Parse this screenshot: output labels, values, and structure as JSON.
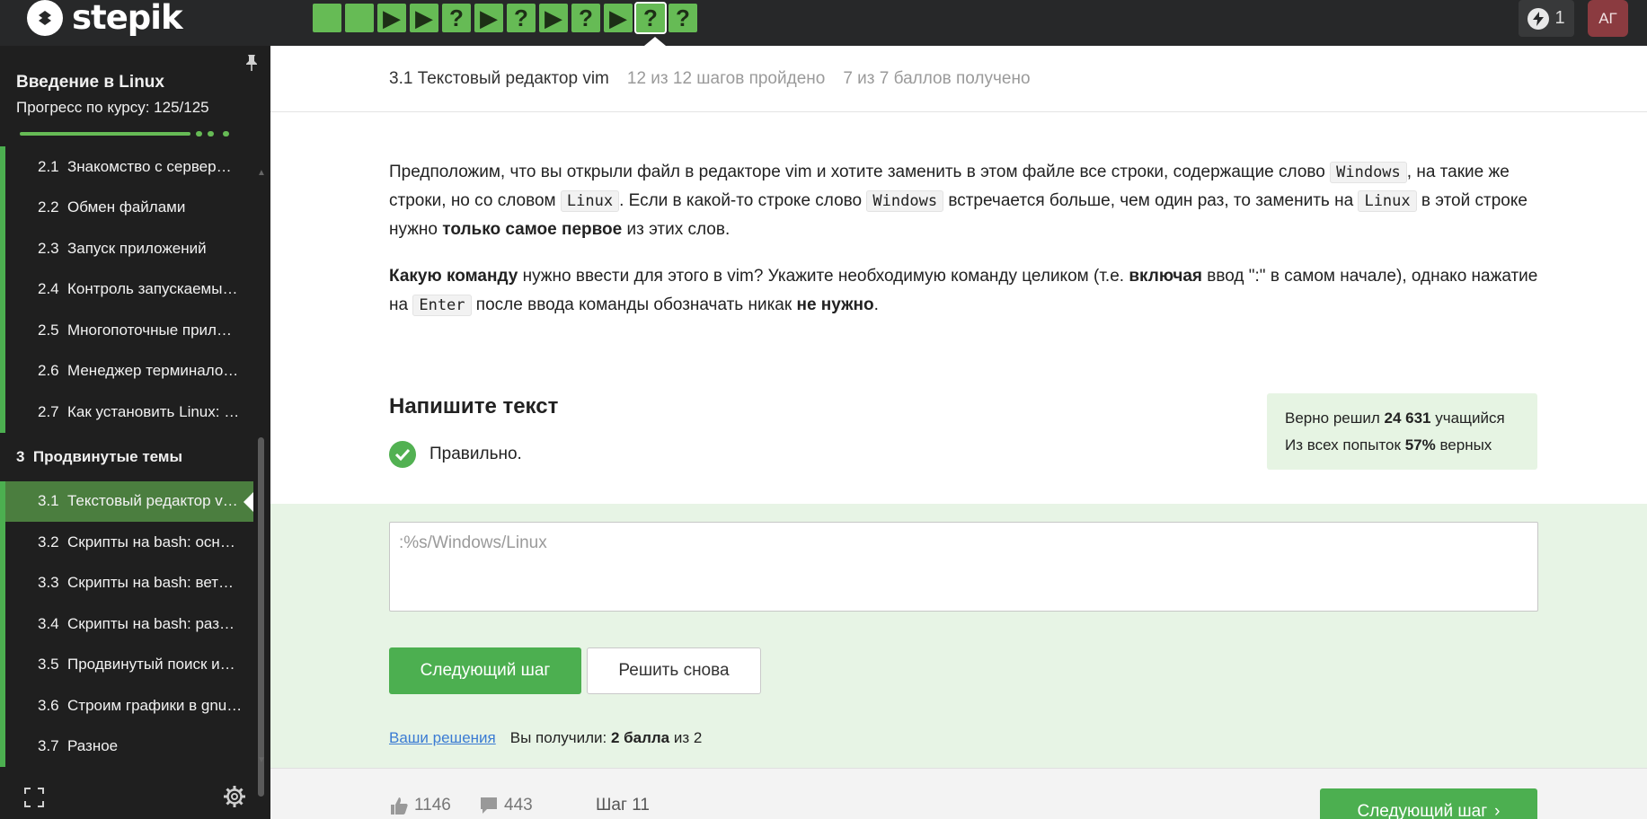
{
  "brand": {
    "name": "stepik"
  },
  "steps": [
    {
      "kind": "text",
      "icon": "",
      "state": "done"
    },
    {
      "kind": "text",
      "icon": "",
      "state": "done"
    },
    {
      "kind": "video",
      "icon": "▶",
      "state": "done"
    },
    {
      "kind": "video",
      "icon": "▶",
      "state": "done"
    },
    {
      "kind": "quiz",
      "icon": "?",
      "state": "done"
    },
    {
      "kind": "video",
      "icon": "▶",
      "state": "done"
    },
    {
      "kind": "quiz",
      "icon": "?",
      "state": "done"
    },
    {
      "kind": "video",
      "icon": "▶",
      "state": "done"
    },
    {
      "kind": "quiz",
      "icon": "?",
      "state": "done"
    },
    {
      "kind": "video",
      "icon": "▶",
      "state": "done"
    },
    {
      "kind": "quiz",
      "icon": "?",
      "state": "current"
    },
    {
      "kind": "quiz",
      "icon": "?",
      "state": "done"
    }
  ],
  "header": {
    "energy_count": "1",
    "avatar_initials": "АГ"
  },
  "sidebar": {
    "course_title": "Введение в Linux",
    "progress_label": "Прогресс по курсу:  125/125",
    "progress_fraction": 1.0,
    "lessons_before": [
      {
        "num": "2.1",
        "title": "Знакомство с сервер…"
      },
      {
        "num": "2.2",
        "title": "Обмен файлами"
      },
      {
        "num": "2.3",
        "title": "Запуск приложений"
      },
      {
        "num": "2.4",
        "title": "Контроль запускаемы…"
      },
      {
        "num": "2.5",
        "title": "Многопоточные прил…"
      },
      {
        "num": "2.6",
        "title": "Менеджер терминало…"
      },
      {
        "num": "2.7",
        "title": "Как установить Linux: …"
      }
    ],
    "section": {
      "num": "3",
      "title": "Продвинутые темы"
    },
    "lessons_after": [
      {
        "num": "3.1",
        "title": "Текстовый редактор v…",
        "active": true
      },
      {
        "num": "3.2",
        "title": "Скрипты на bash: осн…"
      },
      {
        "num": "3.3",
        "title": "Скрипты на bash: вет…"
      },
      {
        "num": "3.4",
        "title": "Скрипты на bash: раз…"
      },
      {
        "num": "3.5",
        "title": "Продвинутый поиск и…"
      },
      {
        "num": "3.6",
        "title": "Строим графики в gnu…"
      },
      {
        "num": "3.7",
        "title": "Разное"
      }
    ]
  },
  "lesson_header": {
    "title": "3.1 Текстовый редактор vim",
    "steps_done": "12 из 12 шагов пройдено",
    "points": "7 из 7 баллов  получено"
  },
  "problem": {
    "p1_a": "Предположим, что вы открыли файл в редакторе vim и хотите заменить в этом файле все строки, содержащие слово ",
    "code_windows": "Windows",
    "p1_b": ", на такие же строки, но со словом ",
    "code_linux": "Linux",
    "p1_c": ". Если в какой-то строке слово ",
    "p1_d": " встречается больше, чем один раз, то заменить на ",
    "p1_e": " в этой строке нужно ",
    "p1_bold": "только самое первое",
    "p1_f": " из этих слов.",
    "p2_bold1": "Какую команду",
    "p2_a": " нужно ввести для этого в vim? Укажите необходимую команду целиком (т.е. ",
    "p2_bold2": "включая",
    "p2_b": " ввод \":\" в самом начале), однако нажатие на ",
    "code_enter": "Enter",
    "p2_c": " после ввода команды обозначать никак ",
    "p2_bold3": "не нужно",
    "p2_d": "."
  },
  "task": {
    "title": "Напишите текст",
    "status": "Правильно."
  },
  "stats": {
    "solved_prefix": "Верно решил ",
    "solved_count": "24 631",
    "solved_suffix": " учащийся",
    "attempts_prefix": "Из всех попыток ",
    "attempts_pct": "57%",
    "attempts_suffix": " верных"
  },
  "answer": {
    "value": ":%s/Windows/Linux"
  },
  "buttons": {
    "next_step": "Следующий шаг",
    "retry": "Решить снова",
    "next_step_bottom": "Следующий шаг"
  },
  "score": {
    "your_solutions": "Ваши решения",
    "got_prefix": "Вы получили: ",
    "got_bold": "2 балла",
    "got_suffix": " из 2"
  },
  "footer": {
    "likes": "1146",
    "dislikes": "443",
    "step_label": "Шаг 11"
  },
  "colors": {
    "accent_green": "#4caf50",
    "step_green": "#66bb55",
    "topbar": "#272829",
    "sidebar": "#1f1f1f",
    "active_lesson": "#4b7e3f",
    "answer_bg": "#e7f4e5",
    "avatar_bg": "#8b3b40"
  }
}
